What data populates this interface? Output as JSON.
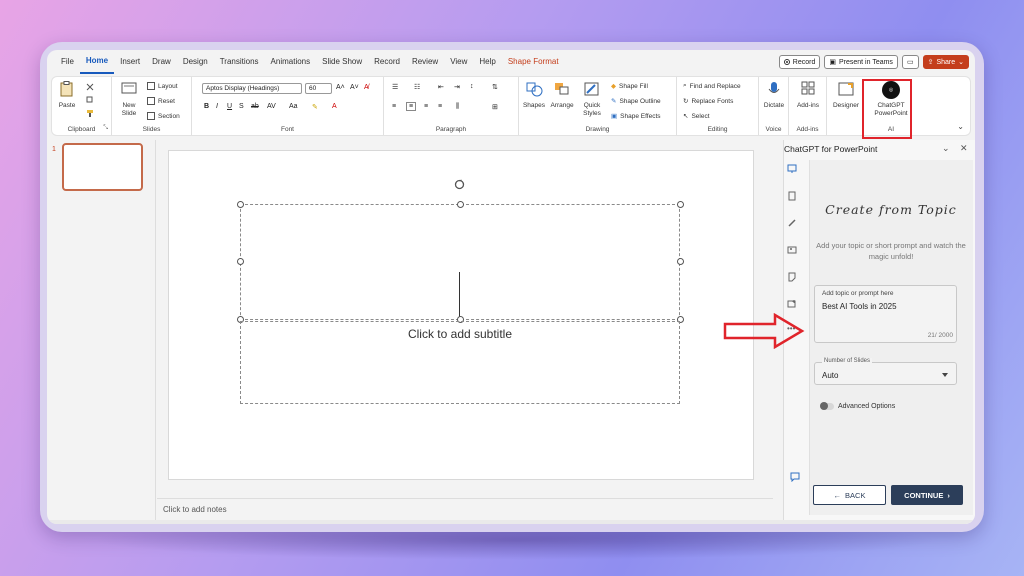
{
  "menu": {
    "tabs": [
      "File",
      "Home",
      "Insert",
      "Draw",
      "Design",
      "Transitions",
      "Animations",
      "Slide Show",
      "Record",
      "Review",
      "View",
      "Help",
      "Shape Format"
    ],
    "active": "Home",
    "record": "Record",
    "present": "Present in Teams",
    "share": "Share"
  },
  "ribbon": {
    "clipboard": {
      "paste": "Paste",
      "label": "Clipboard"
    },
    "slides": {
      "new_slide": "New Slide",
      "layout": "Layout",
      "reset": "Reset",
      "section": "Section",
      "label": "Slides"
    },
    "font": {
      "family": "Aptos Display (Headings)",
      "size": "60",
      "label": "Font"
    },
    "paragraph": {
      "label": "Paragraph"
    },
    "drawing": {
      "shapes": "Shapes",
      "arrange": "Arrange",
      "quick_styles": "Quick Styles",
      "shape_fill": "Shape Fill",
      "shape_outline": "Shape Outline",
      "shape_effects": "Shape Effects",
      "label": "Drawing"
    },
    "editing": {
      "find": "Find and Replace",
      "replace_fonts": "Replace Fonts",
      "select": "Select",
      "label": "Editing"
    },
    "voice": {
      "dictate": "Dictate",
      "label": "Voice"
    },
    "addins": {
      "addins": "Add-ins",
      "label": "Add-ins"
    },
    "designer": "Designer",
    "ai": {
      "chatgpt": "ChatGPT PowerPoint",
      "label": "AI"
    }
  },
  "thumbnails": {
    "number": "1"
  },
  "slide": {
    "subtitle_placeholder": "Click to add subtitle"
  },
  "notes": "Click to add notes",
  "panel": {
    "title": "ChatGPT for PowerPoint",
    "heading": "Create from Topic",
    "description": "Add your topic or short prompt and watch the magic unfold!",
    "topic_label": "Add topic or prompt here",
    "topic_value": "Best AI Tools in 2025",
    "char_count": "21/ 2000",
    "slides_label": "Number of Slides",
    "slides_value": "Auto",
    "advanced": "Advanced Options",
    "back": "BACK",
    "continue": "CONTINUE"
  },
  "colors": {
    "accent": "#185abd",
    "highlight": "#e0242b",
    "share": "#c43e1c",
    "button": "#2c3e5a"
  }
}
